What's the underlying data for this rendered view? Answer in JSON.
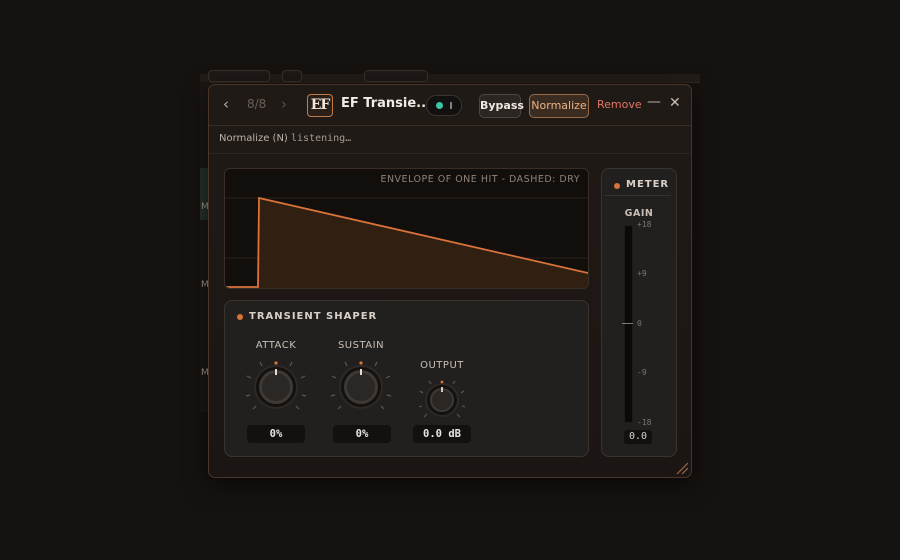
{
  "window": {
    "counter": "8/8",
    "title": "EF Transie...",
    "logo_text": "EF",
    "buttons": {
      "bypass": "Bypass",
      "normalize": "Normalize",
      "remove": "Remove"
    }
  },
  "status": {
    "prefix": "Normalize (N)",
    "text": "listening…"
  },
  "envelope": {
    "caption": "ENVELOPE OF ONE HIT - DASHED: DRY"
  },
  "transient_shaper": {
    "title": "TRANSIENT SHAPER",
    "knobs": [
      {
        "label": "ATTACK",
        "value": "0%"
      },
      {
        "label": "SUSTAIN",
        "value": "0%"
      },
      {
        "label": "OUTPUT",
        "value": "0.0 dB"
      }
    ]
  },
  "meter": {
    "title": "METER",
    "gain_label": "GAIN",
    "ticks": [
      "+18",
      "+9",
      "0",
      "-9",
      "-18"
    ],
    "readout": "0.0"
  },
  "host": {
    "m_label": "M"
  },
  "colors": {
    "accent": "#d9733a",
    "toggle_on": "#3cc6a8",
    "remove": "#e07666"
  }
}
